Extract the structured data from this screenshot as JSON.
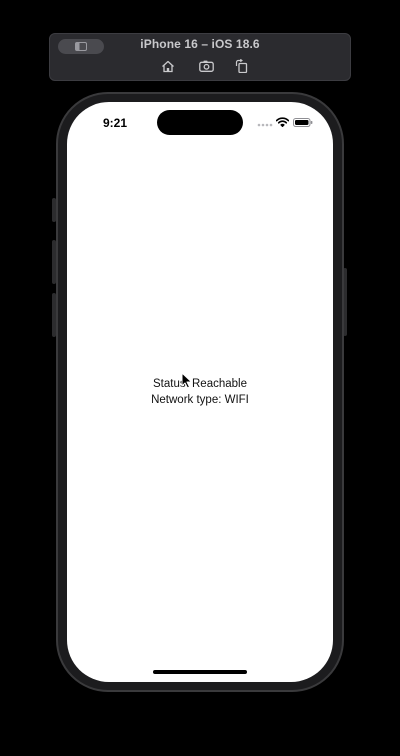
{
  "simulator": {
    "title": "iPhone 16 – iOS 18.6",
    "toolbar_icons": [
      "sidebar-icon",
      "home-icon",
      "screenshot-icon",
      "rotate-icon"
    ]
  },
  "status_bar": {
    "time": "9:21",
    "icons": [
      "cellular-signal-icon",
      "wifi-icon",
      "battery-icon"
    ]
  },
  "app": {
    "status_line": "Status: Reachable",
    "network_line": "Network type: WIFI"
  },
  "colors": {
    "background": "#000000",
    "toolbar": "#2b2b2f",
    "screen": "#ffffff",
    "text": "#111111"
  }
}
